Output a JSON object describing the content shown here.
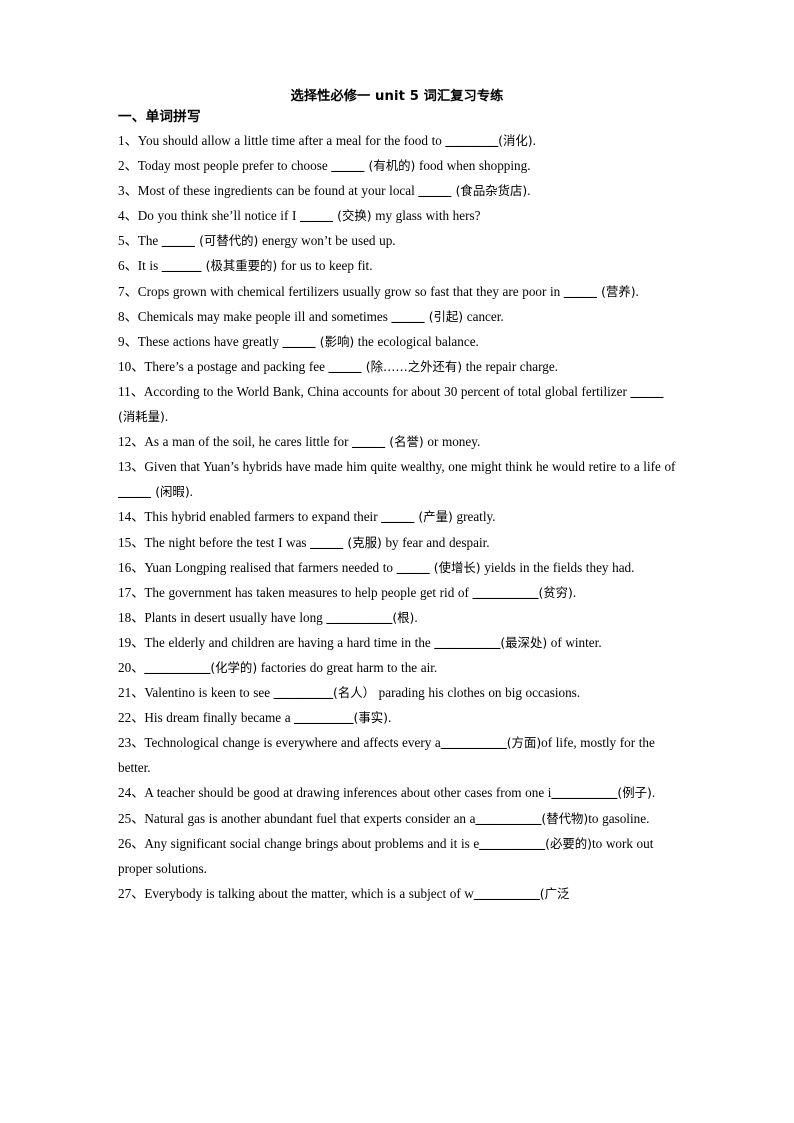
{
  "document": {
    "title": "选择性必修一 unit 5 词汇复习专练",
    "section_heading": "一、单词拼写",
    "questions": [
      {
        "num": "1、",
        "before": "You should allow a little time after a meal for the food to ",
        "blank": "________",
        "hint": "(消化)",
        "after": "."
      },
      {
        "num": "2、",
        "before": "Today most people prefer to choose ",
        "blank": "_____",
        "hint": " (有机的)",
        "after": " food when shopping."
      },
      {
        "num": "3、",
        "before": "Most of these ingredients can be found at your local ",
        "blank": "_____",
        "hint": " (食品杂货店)",
        "after": "."
      },
      {
        "num": "4、",
        "before": "Do you think she’ll notice if I ",
        "blank": "_____",
        "hint": " (交换)",
        "after": " my glass with hers?"
      },
      {
        "num": "5、",
        "before": "The ",
        "blank": "_____",
        "hint": " (可替代的)",
        "after": " energy won’t be used up."
      },
      {
        "num": "6、",
        "before": "It is ",
        "blank": "______",
        "hint": " (极其重要的)",
        "after": " for us to keep fit."
      },
      {
        "num": "7、",
        "before": "Crops grown with chemical fertilizers usually grow so fast that they are poor in ",
        "blank": "_____",
        "hint": " (营养)",
        "after": "."
      },
      {
        "num": "8、",
        "before": "Chemicals may make people ill and sometimes ",
        "blank": "_____",
        "hint": " (引起)",
        "after": " cancer."
      },
      {
        "num": "9、",
        "before": "These actions have greatly ",
        "blank": "_____",
        "hint": " (影响)",
        "after": " the ecological balance."
      },
      {
        "num": "10、",
        "before": "There’s a postage and packing fee ",
        "blank": "_____",
        "hint": " (除……之外还有)",
        "after": " the repair charge."
      },
      {
        "num": "11、",
        "before": "According to the World Bank, China accounts for about 30 percent of total global fertilizer ",
        "blank": "_____",
        "hint": " (消耗量)",
        "after": "."
      },
      {
        "num": "12、",
        "before": "As a man of the soil, he cares little for ",
        "blank": "_____",
        "hint": " (名誉)",
        "after": " or money."
      },
      {
        "num": "13、",
        "before": "Given that Yuan’s hybrids have made him quite wealthy, one might think he would retire to a life of ",
        "blank": "_____",
        "hint": " (闲暇)",
        "after": "."
      },
      {
        "num": "14、",
        "before": "This hybrid enabled farmers to expand their ",
        "blank": "_____",
        "hint": " (产量)",
        "after": " greatly."
      },
      {
        "num": "15、",
        "before": "The night before the test I was ",
        "blank": "_____",
        "hint": " (克服)",
        "after": " by fear and despair."
      },
      {
        "num": "16、",
        "before": "Yuan Longping realised that farmers needed to ",
        "blank": "_____",
        "hint": " (使增长)",
        "after": " yields in the fields they had."
      },
      {
        "num": "17、",
        "before": "The government has taken measures to help people get rid of ",
        "blank": "__________",
        "hint": "(贫穷)",
        "after": "."
      },
      {
        "num": "18、",
        "before": "Plants in desert usually have long ",
        "blank": "__________",
        "hint": "(根)",
        "after": "."
      },
      {
        "num": "19、",
        "before": "The elderly and children are having a hard time in the ",
        "blank": "__________",
        "hint": "(最深处)",
        "after": " of winter."
      },
      {
        "num": "20、",
        "before": "",
        "blank": "__________",
        "hint": "(化学的)",
        "after": " factories do great harm to the air."
      },
      {
        "num": "21、",
        "before": "Valentino is keen to see ",
        "blank": "_________",
        "hint": "(名人）",
        "after": " parading his clothes on big occasions."
      },
      {
        "num": "22、",
        "before": "His dream finally became a ",
        "blank": "_________",
        "hint": "(事实)",
        "after": "."
      },
      {
        "num": "23、",
        "before": "Technological change is everywhere and affects every a",
        "blank": "__________",
        "hint": "(方面)",
        "after": "of life, mostly for the better."
      },
      {
        "num": "24、",
        "before": "A teacher should be good at drawing inferences about other cases from one i",
        "blank": "__________",
        "hint": "(例子)",
        "after": "."
      },
      {
        "num": "25、",
        "before": "Natural gas is another abundant fuel that experts consider an a",
        "blank": "__________",
        "hint": "(替代物)",
        "after": "to gasoline."
      },
      {
        "num": "26、",
        "before": "Any significant social change brings about problems and it is e",
        "blank": "__________",
        "hint": "(必要的)",
        "after": "to work out proper solutions."
      },
      {
        "num": "27、",
        "before": "Everybody is talking about the matter, which is a subject of w",
        "blank": "__________",
        "hint": "(广泛",
        "after": ""
      }
    ]
  }
}
